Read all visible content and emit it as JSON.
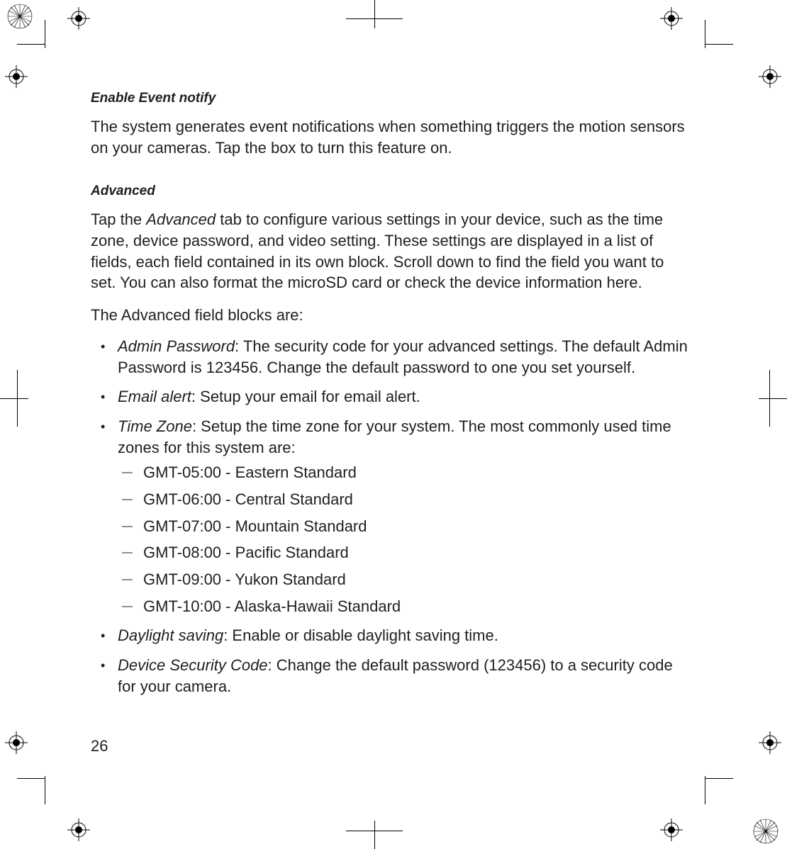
{
  "page_number": "26",
  "sections": {
    "enable_event": {
      "heading": "Enable Event notify",
      "body": "The system generates event notifications when something triggers the motion sensors on your cameras. Tap the box to turn this feature on."
    },
    "advanced": {
      "heading": "Advanced",
      "intro_pre": "Tap the ",
      "intro_term": "Advanced",
      "intro_post": " tab to configure various settings in your device, such as the time zone, device password, and video setting. These settings are displayed in a list of fields, each field contained in its own block. Scroll down to find the field you want to set. You can also format the microSD card or check the device information here.",
      "lead": "The Advanced field blocks are:",
      "items": [
        {
          "term": "Admin Password",
          "desc": ": The security code for your advanced settings. The default Admin Password is 123456. Change the default password to one you set yourself."
        },
        {
          "term": "Email alert",
          "desc": ": Setup your email for email alert."
        },
        {
          "term": "Time Zone",
          "desc": ": Setup the time zone for your system. The most commonly used time zones for this system are:",
          "sub": [
            "GMT-05:00 - Eastern Standard",
            "GMT-06:00 - Central Standard",
            "GMT-07:00 - Mountain Standard",
            "GMT-08:00 - Pacific Standard",
            "GMT-09:00 - Yukon Standard",
            "GMT-10:00 - Alaska-Hawaii Standard"
          ]
        },
        {
          "term": "Daylight saving",
          "desc": ":  Enable or disable daylight saving time."
        },
        {
          "term": "Device Security Code",
          "desc": ": Change the default password (123456) to a security code for your camera."
        }
      ]
    }
  }
}
